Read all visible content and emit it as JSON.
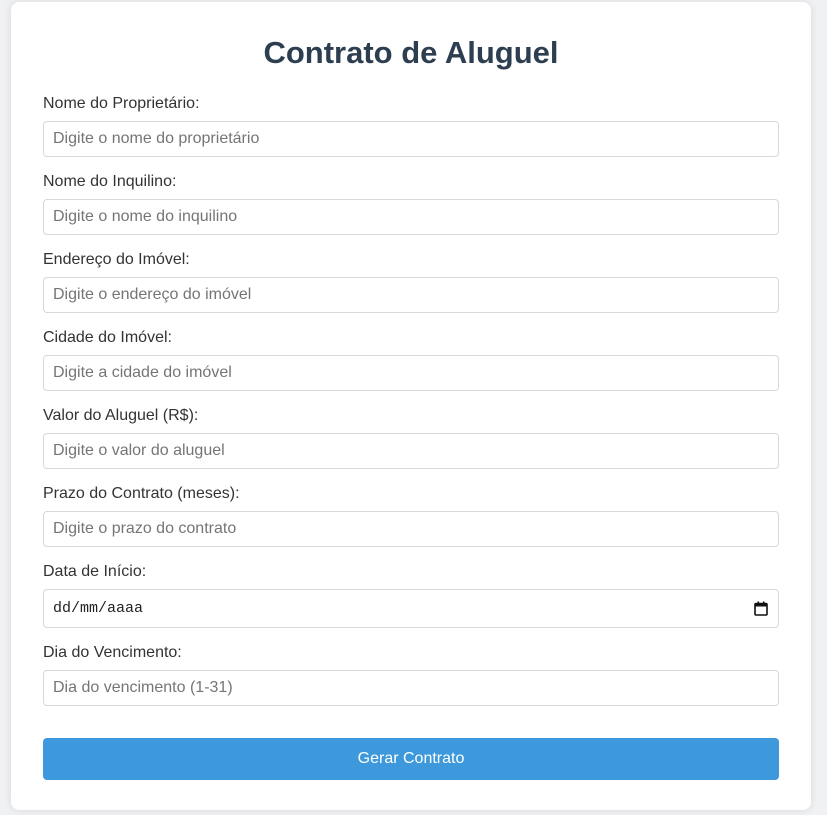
{
  "page": {
    "title": "Contrato de Aluguel"
  },
  "form": {
    "fields": [
      {
        "label": "Nome do Proprietário:",
        "placeholder": "Digite o nome do proprietário"
      },
      {
        "label": "Nome do Inquilino:",
        "placeholder": "Digite o nome do inquilino"
      },
      {
        "label": "Endereço do Imóvel:",
        "placeholder": "Digite o endereço do imóvel"
      },
      {
        "label": "Cidade do Imóvel:",
        "placeholder": "Digite a cidade do imóvel"
      },
      {
        "label": "Valor do Aluguel (R$):",
        "placeholder": "Digite o valor do aluguel"
      },
      {
        "label": "Prazo do Contrato (meses):",
        "placeholder": "Digite o prazo do contrato"
      },
      {
        "label": "Data de Início:",
        "value": "dd/mm/aaaa",
        "icon": "calendar-icon"
      },
      {
        "label": "Dia do Vencimento:",
        "placeholder": "Dia do vencimento (1-31)"
      }
    ],
    "submit_label": "Gerar Contrato"
  },
  "colors": {
    "title": "#2c3e50",
    "button": "#3d99db",
    "border": "#d5d8dc"
  }
}
